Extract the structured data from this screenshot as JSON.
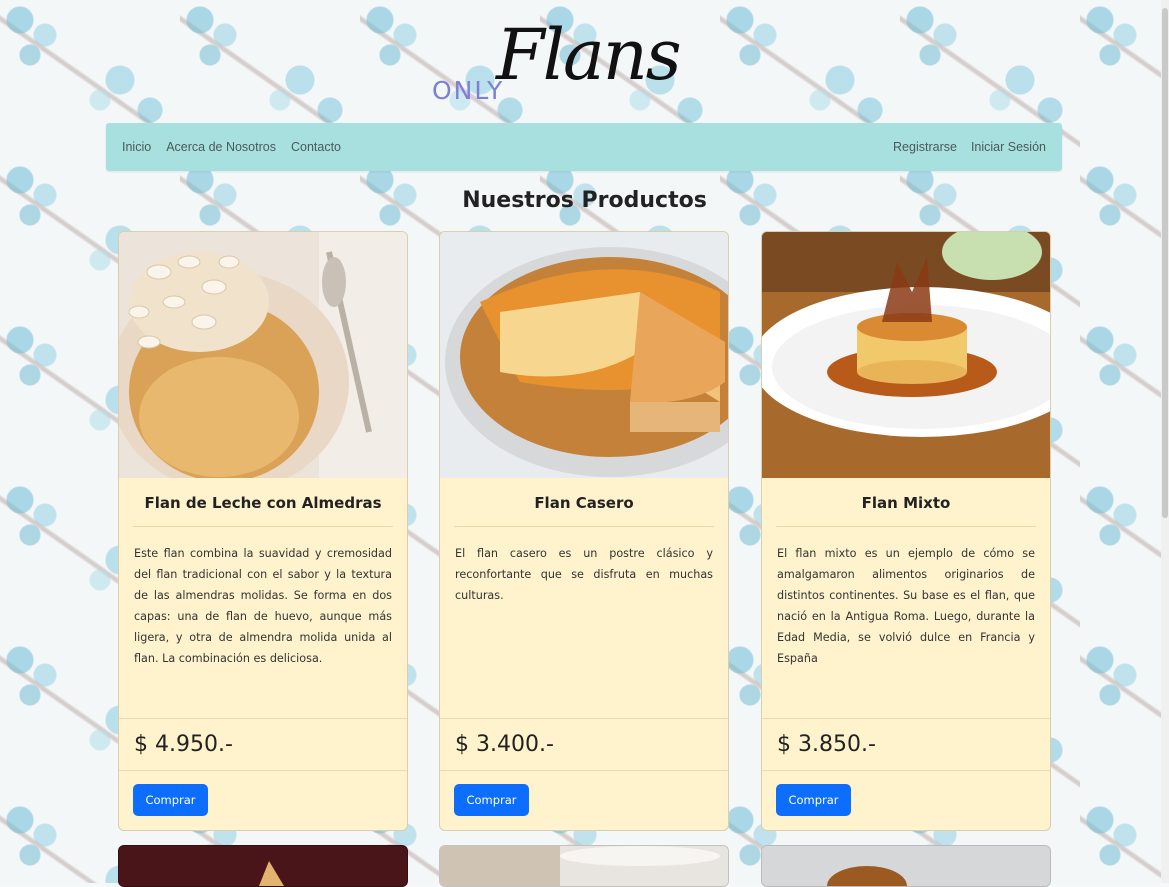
{
  "logo": {
    "prefix": "ONLY",
    "name": "Flans"
  },
  "nav": {
    "left": [
      "Inicio",
      "Acerca de Nosotros",
      "Contacto"
    ],
    "right": [
      "Registrarse",
      "Iniciar Sesión"
    ]
  },
  "section_title": "Nuestros Productos",
  "products": [
    {
      "title": "Flan de Leche con Almedras",
      "description": "Este flan combina la suavidad y cremosidad del flan tradicional con el sabor y la textura de las almendras molidas. Se forma en dos capas: una de flan de huevo, aunque más ligera, y otra de almendra molida unida al flan. La combinación es deliciosa.",
      "price": "$ 4.950.-",
      "button": "Comprar"
    },
    {
      "title": "Flan Casero",
      "description": "El flan casero es un postre clásico y reconfortante que se disfruta en muchas culturas.",
      "price": "$ 3.400.-",
      "button": "Comprar"
    },
    {
      "title": "Flan Mixto",
      "description": "El flan mixto es un ejemplo de cómo se amalgamaron alimentos originarios de distintos continentes. Su base es el flan, que nació en la Antigua Roma. Luego, durante la Edad Media, se volvió dulce en Francia y España",
      "price": "$ 3.850.-",
      "button": "Comprar"
    }
  ],
  "colors": {
    "navbar": "#a8e0e0",
    "card": "#fff3cd",
    "button": "#0d6efd",
    "logo_prefix": "#7b7fd6"
  }
}
